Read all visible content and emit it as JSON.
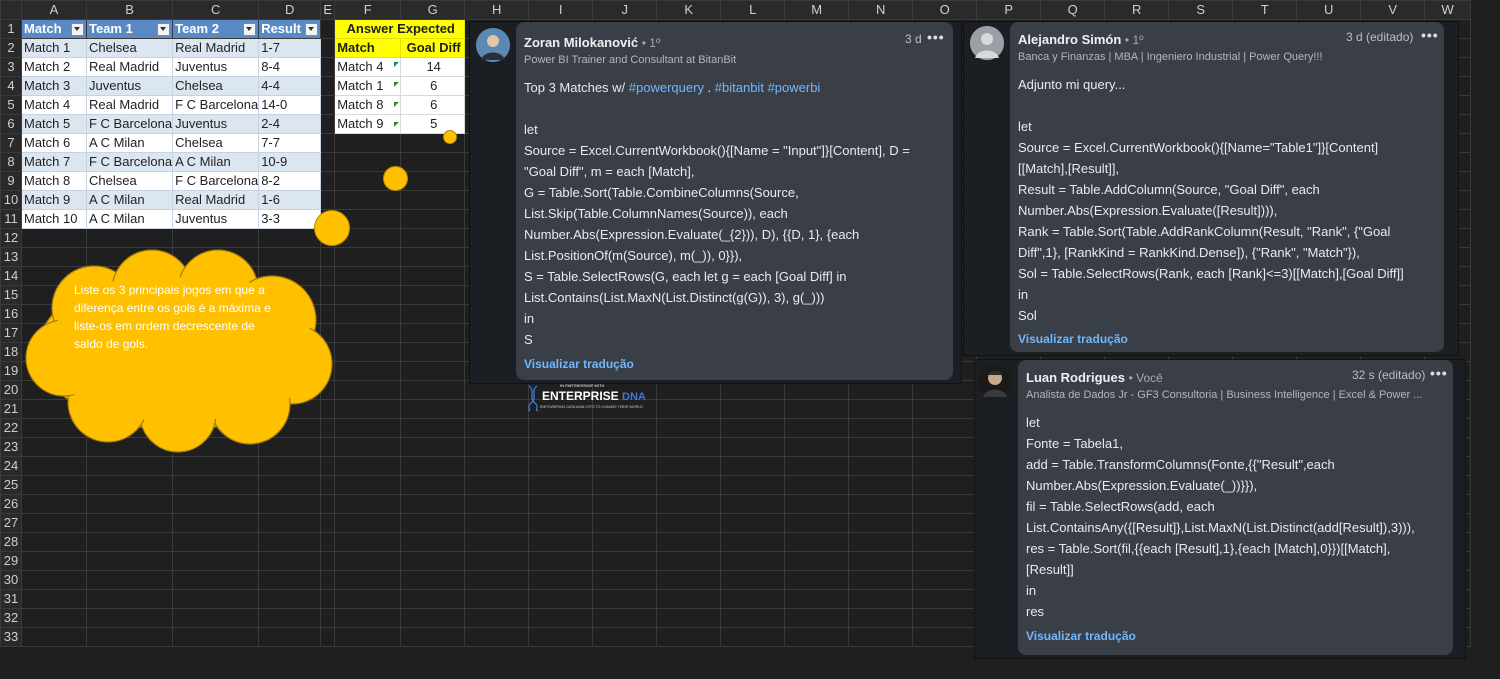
{
  "spreadsheet": {
    "columns": [
      "A",
      "B",
      "C",
      "D",
      "E",
      "F",
      "G",
      "H",
      "I",
      "J",
      "K",
      "L",
      "M",
      "N",
      "O",
      "P",
      "Q",
      "R",
      "S",
      "T",
      "U",
      "V",
      "W"
    ],
    "rows": [
      "1",
      "2",
      "3",
      "4",
      "5",
      "6",
      "7",
      "8",
      "9",
      "10",
      "11",
      "12",
      "13",
      "14",
      "15",
      "16",
      "17",
      "18",
      "19",
      "20",
      "21",
      "22",
      "23",
      "24",
      "25",
      "26",
      "27",
      "28",
      "29",
      "30",
      "31",
      "32",
      "33"
    ],
    "table": {
      "headers": [
        "Match",
        "Team 1",
        "Team 2",
        "Result"
      ],
      "rows": [
        [
          "Match 1",
          "Chelsea",
          "Real Madrid",
          "1-7"
        ],
        [
          "Match 2",
          "Real Madrid",
          "Juventus",
          "8-4"
        ],
        [
          "Match 3",
          "Juventus",
          "Chelsea",
          "4-4"
        ],
        [
          "Match 4",
          "Real Madrid",
          "F C Barcelona",
          "14-0"
        ],
        [
          "Match 5",
          "F C Barcelona",
          "Juventus",
          "2-4"
        ],
        [
          "Match 6",
          "A C Milan",
          "Chelsea",
          "7-7"
        ],
        [
          "Match 7",
          "F C Barcelona",
          "A C Milan",
          "10-9"
        ],
        [
          "Match 8",
          "Chelsea",
          "F C Barcelona",
          "8-2"
        ],
        [
          "Match 9",
          "A C Milan",
          "Real Madrid",
          "1-6"
        ],
        [
          "Match 10",
          "A C Milan",
          "Juventus",
          "3-3"
        ]
      ]
    },
    "answer": {
      "title": "Answer Expected",
      "headers": [
        "Match",
        "Goal Diff"
      ],
      "rows": [
        [
          "Match 4",
          "14"
        ],
        [
          "Match 1",
          "6"
        ],
        [
          "Match 8",
          "6"
        ],
        [
          "Match 9",
          "5"
        ]
      ]
    },
    "callout": "Liste os 3 principais jogos em que a diferença entre os gols é a máxima e liste-os em ordem decrescente de saldo de gols.",
    "colors": {
      "header_blue": "#5a8ac6",
      "band": "#dce6f1",
      "yellow": "#ffff00",
      "shape": "#ffc000"
    }
  },
  "comments": [
    {
      "name": "Zoran Milokanović",
      "degree": "• 1º",
      "title": "Power BI Trainer and Consultant at BitanBit",
      "time": "3 d",
      "more": "•••",
      "intro": "Top 3 Matches w/ ",
      "tags": [
        "#powerquery",
        " . ",
        "#bitanbit",
        " ",
        "#powerbi"
      ],
      "lines": [
        "let",
        " Source = Excel.CurrentWorkbook(){[Name = \"Input\"]}[Content], D =",
        "\"Goal Diff\", m = each [Match],",
        " G = Table.Sort(Table.CombineColumns(Source,",
        "List.Skip(Table.ColumnNames(Source)), each",
        "Number.Abs(Expression.Evaluate(_{2})), D), {{D, 1}, {each",
        "List.PositionOf(m(Source), m(_)), 0}}),",
        " S = Table.SelectRows(G, each let g = each [Goal Diff] in",
        "List.Contains(List.MaxN(List.Distinct(g(G)), 3), g(_)))",
        "in",
        " S"
      ],
      "translate": "Visualizar tradução"
    },
    {
      "name": "Alejandro Simón",
      "degree": "• 1º",
      "title": "Banca y Finanzas | MBA | Ingeniero Industrial | Power Query!!!",
      "time": "3 d (editado)",
      "more": "•••",
      "lines": [
        "Adjunto mi query...",
        "",
        "let",
        " Source = Excel.CurrentWorkbook(){[Name=\"Table1\"]}[Content]",
        "[[Match],[Result]],",
        " Result = Table.AddColumn(Source, \"Goal Diff\", each",
        "Number.Abs(Expression.Evaluate([Result]))),",
        " Rank = Table.Sort(Table.AddRankColumn(Result, \"Rank\", {\"Goal",
        "Diff\",1}, [RankKind = RankKind.Dense]), {\"Rank\", \"Match\"}),",
        " Sol = Table.SelectRows(Rank, each [Rank]<=3)[[Match],[Goal Diff]]",
        "in",
        " Sol"
      ],
      "translate": "Visualizar tradução"
    },
    {
      "name": "Luan Rodrigues",
      "degree": "• Você",
      "title": "Analista de Dados Jr - GF3 Consultoria | Business Intelligence | Excel & Power ...",
      "time": "32 s (editado)",
      "more": "•••",
      "lines": [
        "let",
        " Fonte = Tabela1,",
        " add = Table.TransformColumns(Fonte,{{\"Result\",each",
        "Number.Abs(Expression.Evaluate(_))}}),",
        " fil = Table.SelectRows(add, each",
        "List.ContainsAny({[Result]},List.MaxN(List.Distinct(add[Result]),3))),",
        " res = Table.Sort(fil,{{each [Result],1},{each [Match],0}})[[Match],",
        "[Result]]",
        "in",
        " res"
      ],
      "translate": "Visualizar tradução"
    }
  ],
  "logo": {
    "top": "IN PARTNERSHIP WITH",
    "main": "ENTERPRISE",
    "accent": "DNA",
    "sub": "EMPOWERING DATA ANALYSTS TO CHANGE THEIR WORLD"
  }
}
